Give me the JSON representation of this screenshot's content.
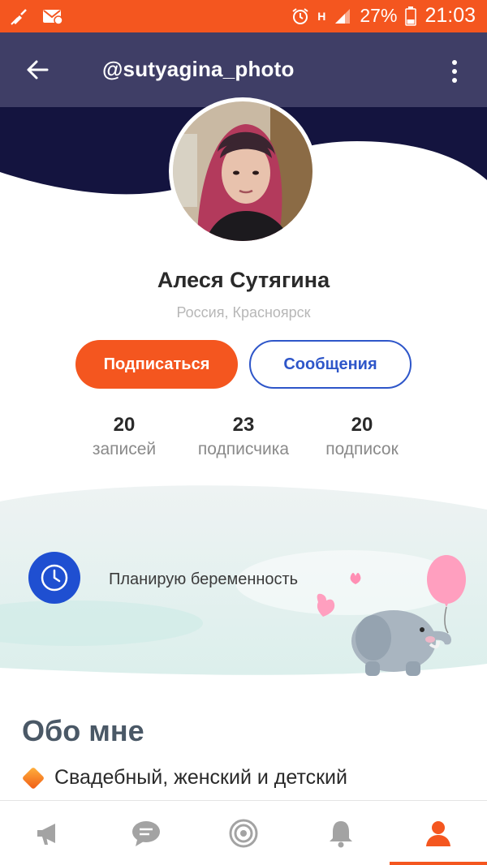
{
  "status_bar": {
    "battery_percent": "27%",
    "time": "21:03",
    "network": "H"
  },
  "app_bar": {
    "username": "@sutyagina_photo"
  },
  "profile": {
    "name": "Алеся Сутягина",
    "location": "Россия, Красноярск"
  },
  "actions": {
    "subscribe_label": "Подписаться",
    "messages_label": "Сообщения"
  },
  "stats": [
    {
      "value": "20",
      "label": "записей"
    },
    {
      "value": "23",
      "label": "подписчика"
    },
    {
      "value": "20",
      "label": "подписок"
    }
  ],
  "status": {
    "text": "Планирую беременность"
  },
  "about": {
    "title": "Обо мне",
    "first_line": "Свадебный, женский и детский"
  },
  "colors": {
    "accent": "#f4561f",
    "app_bar": "#3f3e66",
    "hero": "#14143f",
    "link_blue": "#2e56c9",
    "clock_blue": "#1f4fd1"
  }
}
